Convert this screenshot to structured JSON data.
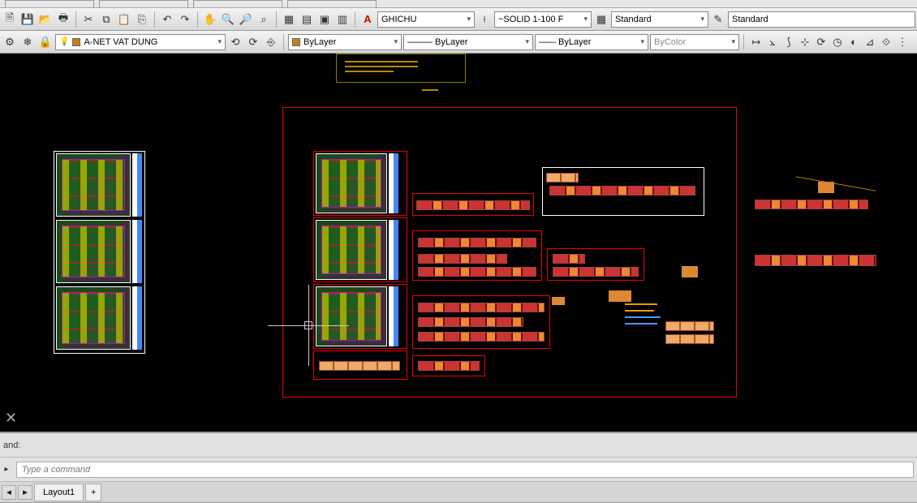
{
  "toolbar1": {
    "icons": [
      "new",
      "save",
      "open",
      "print",
      "cut",
      "copy",
      "paste",
      "clipboard",
      "undo",
      "redo",
      "pan",
      "zoomwin",
      "zoom",
      "zoomext",
      "view",
      "grid",
      "tool1",
      "tool2",
      "tool3"
    ],
    "text_style_label": "A",
    "text_style_value": "GHICHU",
    "dim_style_value": "~SOLID 1-100 F",
    "table_style_value": "Standard",
    "ml_style_value": "Standard"
  },
  "toolbar2": {
    "layer_value": "A-NET VAT DUNG",
    "layer_color": "#c08020",
    "prop_color_label": "ByLayer",
    "prop_color_swatch": "#c08020",
    "prop_linetype_label": "ByLayer",
    "prop_lineweight_label": "ByLayer",
    "prop_plotstyle_label": "ByColor",
    "nav_icons": [
      "measure",
      "dist",
      "angle",
      "coord",
      "refresh",
      "rotate",
      "align",
      "scale",
      "dim"
    ]
  },
  "command": {
    "label": "and:",
    "placeholder": "Type a command"
  },
  "tabs": {
    "layout": "Layout1",
    "add": "+"
  }
}
